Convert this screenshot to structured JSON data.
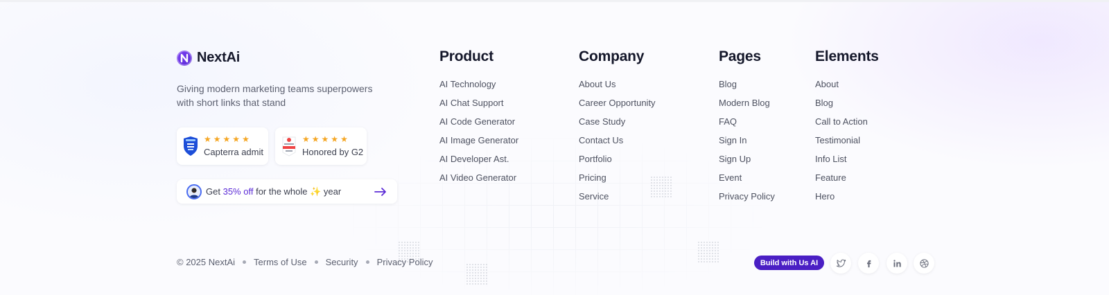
{
  "brand": {
    "name": "NextAi",
    "tagline": "Giving modern marketing teams superpowers with short links that stand"
  },
  "badges": {
    "capterra": {
      "label": "Capterra admit",
      "stars": 5
    },
    "g2": {
      "label": "Honored by G2",
      "stars": 5
    }
  },
  "promo": {
    "prefix": "Get",
    "highlight": "35% off",
    "suffix": "for the whole ✨ year"
  },
  "columns": {
    "product": {
      "title": "Product",
      "items": [
        "AI Technology",
        "AI Chat Support",
        "AI Code Generator",
        "AI Image Generator",
        "AI Developer Ast.",
        "AI Video Generator"
      ]
    },
    "company": {
      "title": "Company",
      "items": [
        "About Us",
        "Career Opportunity",
        "Case Study",
        "Contact Us",
        "Portfolio",
        "Pricing",
        "Service"
      ]
    },
    "pages": {
      "title": "Pages",
      "items": [
        "Blog",
        "Modern Blog",
        "FAQ",
        "Sign In",
        "Sign Up",
        "Event",
        "Privacy Policy"
      ]
    },
    "elements": {
      "title": "Elements",
      "items": [
        "About",
        "Blog",
        "Call to Action",
        "Testimonial",
        "Info List",
        "Feature",
        "Hero"
      ]
    }
  },
  "footer": {
    "copyright": "© 2025 NextAi",
    "links": [
      "Terms of Use",
      "Security",
      "Privacy Policy"
    ],
    "build_button": "Build with Us AI",
    "social": [
      "twitter-icon",
      "facebook-icon",
      "linkedin-icon",
      "dribbble-icon"
    ]
  },
  "colors": {
    "accent": "#5b2bd6",
    "button": "#4a1fc4",
    "star": "#f5a623"
  }
}
